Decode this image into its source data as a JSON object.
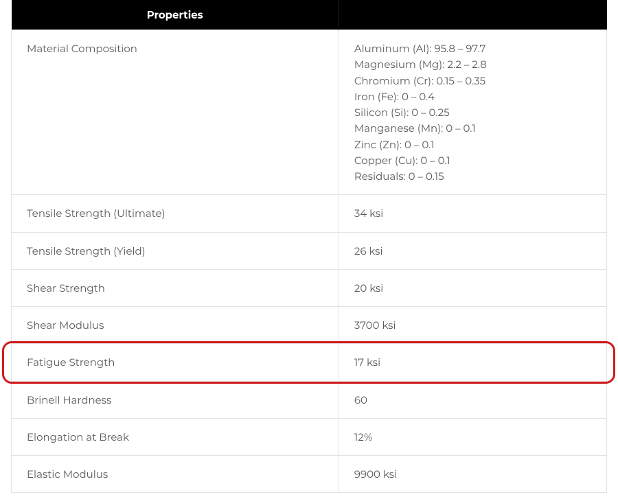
{
  "header": {
    "title": "Properties"
  },
  "rows": [
    {
      "label": "Material Composition",
      "value_lines": [
        "Aluminum (Al): 95.8 – 97.7",
        "Magnesium (Mg): 2.2 – 2.8",
        "Chromium (Cr): 0.15 – 0.35",
        "Iron (Fe): 0 – 0.4",
        "Silicon (Si): 0 – 0.25",
        "Manganese (Mn): 0 – 0.1",
        "Zinc (Zn): 0 – 0.1",
        "Copper (Cu): 0 – 0.1",
        "Residuals: 0 – 0.15"
      ]
    },
    {
      "label": "Tensile Strength (Ultimate)",
      "value": "34 ksi"
    },
    {
      "label": "Tensile Strength (Yield)",
      "value": "26 ksi"
    },
    {
      "label": "Shear Strength",
      "value": "20 ksi"
    },
    {
      "label": "Shear Modulus",
      "value": "3700 ksi"
    },
    {
      "label": "Fatigue Strength",
      "value": "17 ksi",
      "highlighted": true
    },
    {
      "label": "Brinell Hardness",
      "value": "60"
    },
    {
      "label": "Elongation at Break",
      "value": "12%"
    },
    {
      "label": "Elastic Modulus",
      "value": "9900 ksi"
    }
  ]
}
